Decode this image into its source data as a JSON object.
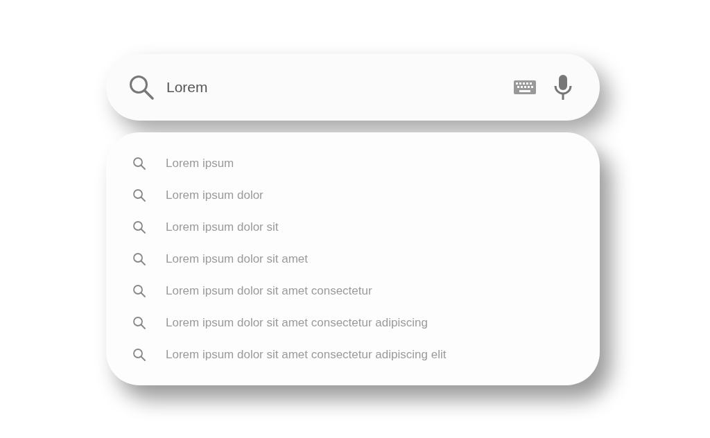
{
  "search": {
    "value": "Lorem"
  },
  "suggestions": [
    {
      "text": "Lorem ipsum"
    },
    {
      "text": "Lorem ipsum dolor"
    },
    {
      "text": "Lorem ipsum dolor sit"
    },
    {
      "text": "Lorem ipsum dolor sit amet"
    },
    {
      "text": "Lorem ipsum dolor sit amet consectetur"
    },
    {
      "text": "Lorem ipsum dolor sit amet consectetur adipiscing"
    },
    {
      "text": "Lorem ipsum dolor sit amet consectetur adipiscing elit"
    }
  ]
}
